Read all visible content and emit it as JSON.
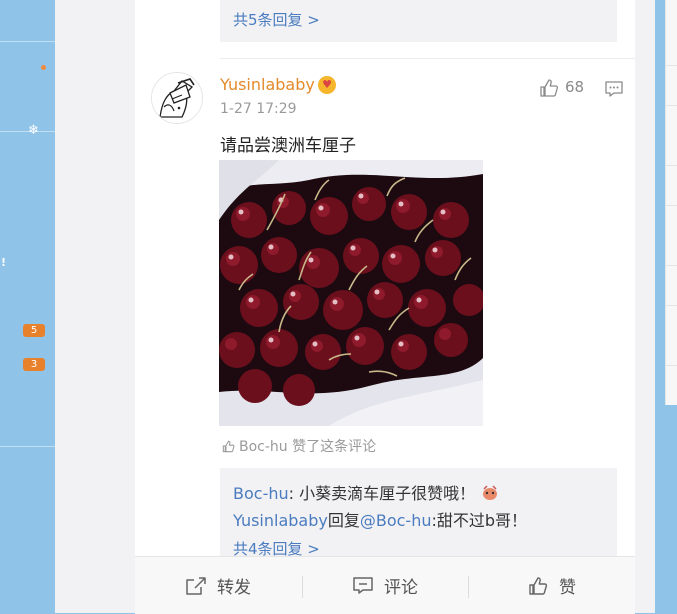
{
  "sidebar": {
    "badges": [
      "5",
      "3"
    ]
  },
  "thread": {
    "prev_more_replies": "共5条回复 >"
  },
  "comment": {
    "username": "Yusinlababy",
    "timestamp": "1-27 17:29",
    "like_count": "68",
    "text": "请品尝澳洲车厘子",
    "liked_by": "Boc-hu 赞了这条评论",
    "replies": [
      {
        "author": "Boc-hu",
        "separator": ": ",
        "text": "小葵卖滴车厘子很赞哦！"
      },
      {
        "author": "Yusinlababy",
        "mid": "回复",
        "mention": "@Boc-hu",
        "separator": ":",
        "text": "甜不过b哥！"
      }
    ],
    "more_replies": "共4条回复 >"
  },
  "actions": {
    "repost": "转发",
    "comment": "评论",
    "like": "赞"
  },
  "colors": {
    "accent_orange": "#e58a2b",
    "link_blue": "#4a7cbf",
    "sidebar_blue": "#8fc3e8",
    "badge_orange": "#e8812c"
  },
  "icons": [
    "gear-icon",
    "like-icon",
    "comment-icon",
    "repost-icon",
    "heart-emoji-icon",
    "reply-emoji-icon"
  ]
}
